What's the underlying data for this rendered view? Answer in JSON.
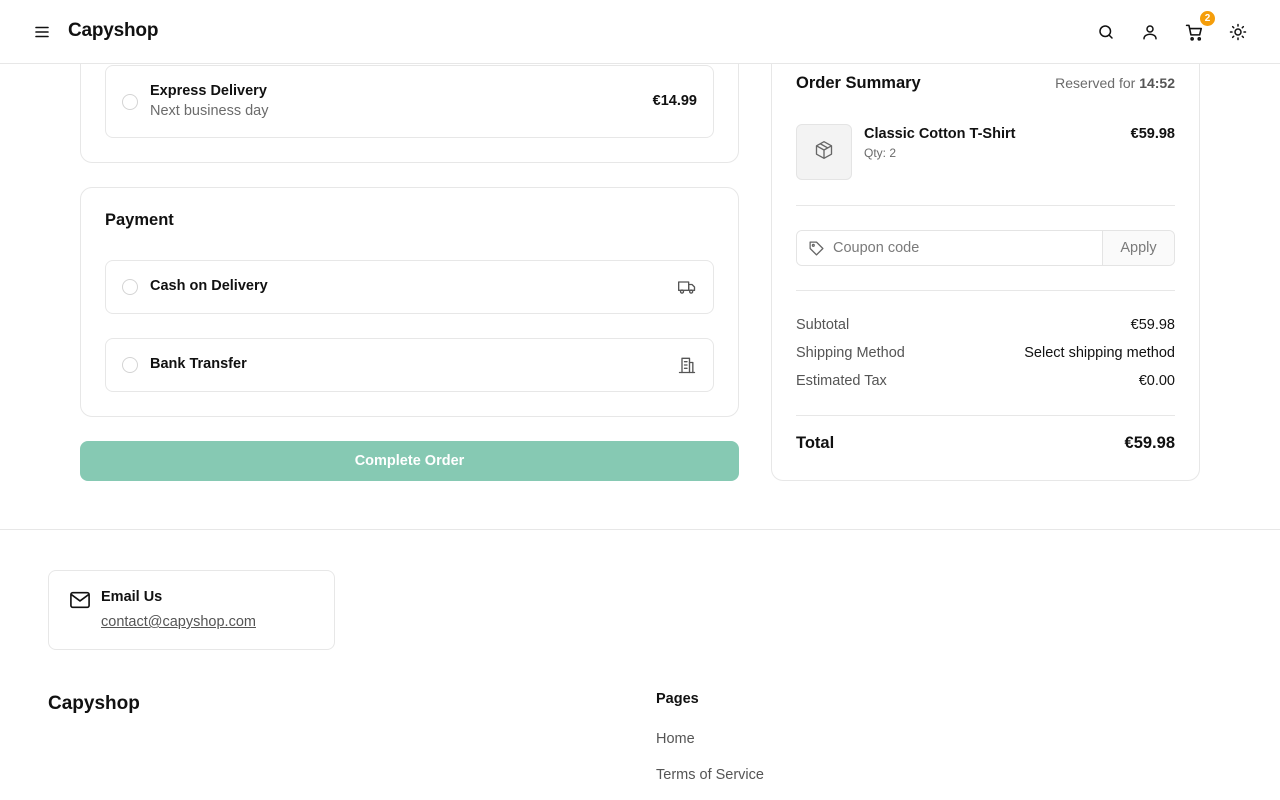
{
  "header": {
    "brand": "Capyshop",
    "cart_count": "2",
    "icons": [
      "menu-icon",
      "search-icon",
      "user-icon",
      "cart-icon",
      "sun-icon"
    ]
  },
  "shipping": {
    "options": [
      {
        "title": "Express Delivery",
        "subtitle": "Next business day",
        "price": "€14.99"
      }
    ]
  },
  "payment": {
    "title": "Payment",
    "options": [
      {
        "title": "Cash on Delivery",
        "icon": "truck-icon"
      },
      {
        "title": "Bank Transfer",
        "icon": "building-icon"
      }
    ]
  },
  "complete_button": "Complete Order",
  "summary": {
    "title": "Order Summary",
    "reserved_prefix": "Reserved for",
    "reserved_time": "14:52",
    "items": [
      {
        "name": "Classic Cotton T-Shirt",
        "qty": "Qty: 2",
        "price": "€59.98",
        "icon": "package-icon"
      }
    ],
    "coupon": {
      "placeholder": "Coupon code",
      "value": "",
      "apply_label": "Apply"
    },
    "lines": [
      {
        "label": "Subtotal",
        "value": "€59.98"
      },
      {
        "label": "Shipping Method",
        "value": "Select shipping method"
      },
      {
        "label": "Estimated Tax",
        "value": "€0.00"
      }
    ],
    "total_label": "Total",
    "total_value": "€59.98"
  },
  "footer": {
    "email_title": "Email Us",
    "email_link": "contact@capyshop.com",
    "brand": "Capyshop",
    "pages_title": "Pages",
    "links": [
      "Home",
      "Terms of Service"
    ]
  },
  "colors": {
    "accent_disabled": "#86c9b3",
    "badge": "#f59e0b",
    "border": "#e7e7e7"
  }
}
